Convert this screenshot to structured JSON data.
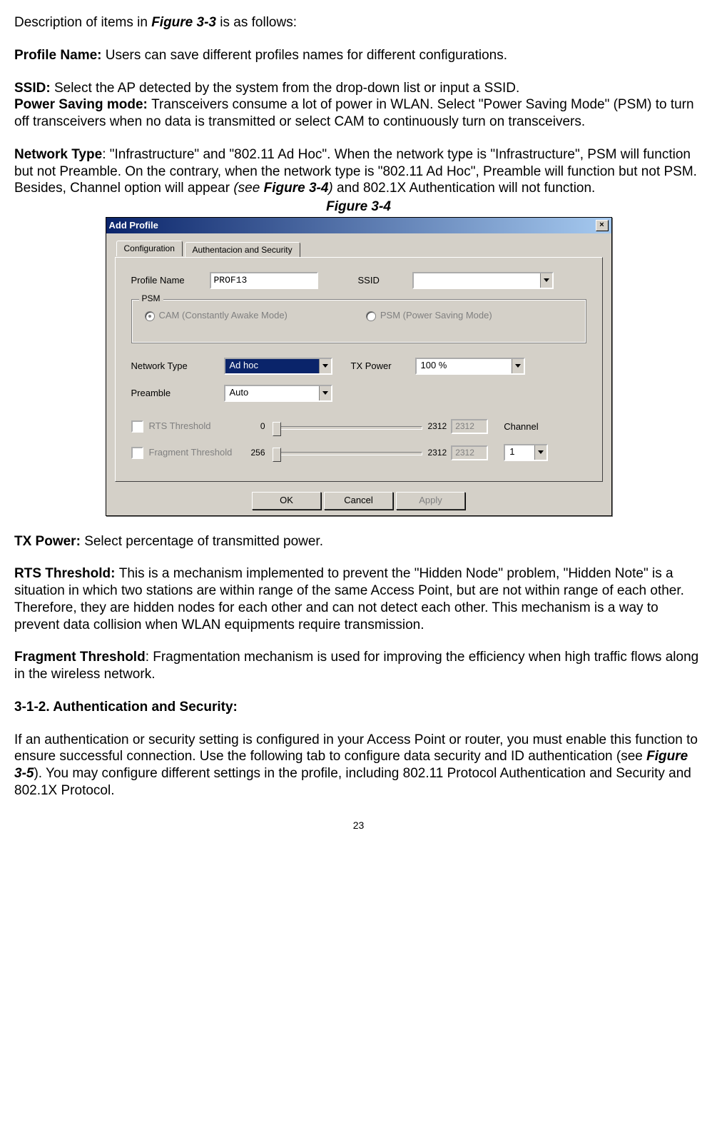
{
  "para_intro": "Description of items in ",
  "para_intro_ref": "Figure 3-3",
  "para_intro_tail": " is as follows:",
  "profile_name_h": "Profile Name: ",
  "profile_name_t": "Users can save different profiles names for different configurations.",
  "ssid_h": "SSID: ",
  "ssid_t": "Select the AP detected by the system from the drop-down list or input a SSID.",
  "psm_h": "Power Saving mode: ",
  "psm_t": "Transceivers consume a lot of power in WLAN. Select \"Power Saving Mode\" (PSM) to turn off transceivers when no data is transmitted or select CAM to continuously turn on transceivers.",
  "nettype_h": "Network Type",
  "nettype_t1": ": \"Infrastructure\" and \"802.11 Ad Hoc\". When the network type is \"Infrastructure\", PSM will function but not Preamble. On the contrary, when the network type is \"802.11 Ad Hoc\", Preamble will function but not PSM. Besides, Channel option will appear ",
  "nettype_see": "(see ",
  "nettype_ref": "Figure 3-4",
  "nettype_seeclose": ")",
  "nettype_t2": " and 802.1X Authentication will not function.",
  "figcap": "Figure 3-4",
  "dialog": {
    "title": "Add Profile",
    "close": "×",
    "tabs": {
      "config": "Configuration",
      "auth": "Authentacion and Security"
    },
    "labels": {
      "profile_name": "Profile Name",
      "ssid": "SSID",
      "psm_group": "PSM",
      "cam": "CAM (Constantly Awake Mode)",
      "psm": "PSM (Power Saving Mode)",
      "network_type": "Network Type",
      "tx_power": "TX Power",
      "preamble": "Preamble",
      "rts": "RTS Threshold",
      "frag": "Fragment Threshold",
      "channel": "Channel"
    },
    "values": {
      "profile_name": "PROF13",
      "network_type": "Ad hoc",
      "tx_power": "100 %",
      "preamble": "Auto",
      "rts_min": "0",
      "rts_max": "2312",
      "rts_val": "2312",
      "frag_min": "256",
      "frag_max": "2312",
      "frag_val": "2312",
      "channel": "1"
    },
    "buttons": {
      "ok": "OK",
      "cancel": "Cancel",
      "apply": "Apply"
    }
  },
  "txpower_h": "TX Power: ",
  "txpower_t": "Select percentage of transmitted power.",
  "rts_h": "RTS Threshold: ",
  "rts_t": "This is a mechanism implemented to prevent the \"Hidden Node\" problem, \"Hidden Note\" is a situation in which two stations are within range of the same Access Point, but are not within range of each other. Therefore, they are hidden nodes for each other and can not detect each other. This mechanism is a way to prevent data collision when WLAN equipments require transmission.",
  "frag_h": "Fragment Threshold",
  "frag_t": ": Fragmentation mechanism is used for improving the efficiency when high traffic flows along in the wireless network.",
  "sec_h": "3-1-2. Authentication and Security:",
  "sec_p1a": "If an authentication or security setting is configured in your Access Point or router, you must enable this function to ensure successful connection. Use the following tab to configure data security and ID authentication (see ",
  "sec_p1ref": "Figure 3-5",
  "sec_p1b": "). You may configure different settings in the profile, including 802.11 Protocol Authentication and Security and 802.1X Protocol.",
  "pagenum": "23"
}
